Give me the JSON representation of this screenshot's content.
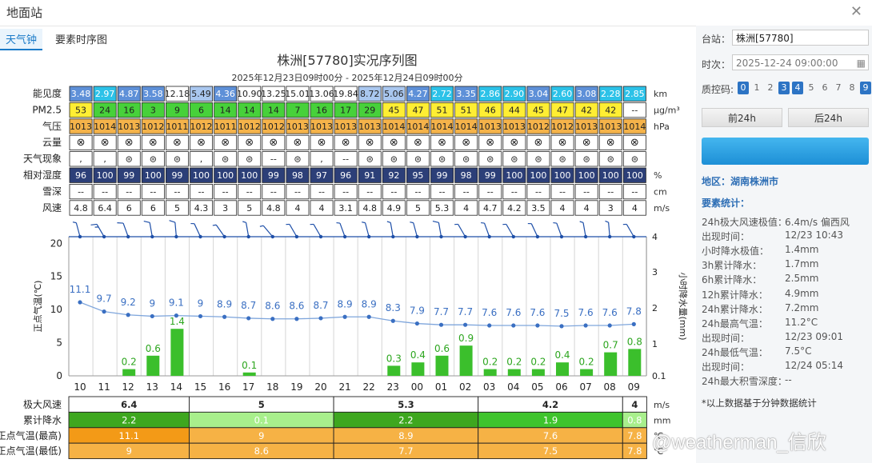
{
  "window": {
    "title": "地面站",
    "close_icon": "close-icon"
  },
  "tabs": [
    {
      "label": "天气钟",
      "active": true
    },
    {
      "label": "要素时序图",
      "active": false
    }
  ],
  "chart_header": {
    "title": "株洲[57780]实况序列图",
    "subtitle": "2025年12月23日09时00分 - 2025年12月24日09时00分"
  },
  "table": {
    "hours": [
      "10",
      "11",
      "12",
      "13",
      "14",
      "15",
      "16",
      "17",
      "18",
      "19",
      "20",
      "21",
      "22",
      "23",
      "00",
      "01",
      "02",
      "03",
      "04",
      "05",
      "06",
      "07",
      "08",
      "09"
    ],
    "rows": [
      {
        "label": "能见度",
        "unit": "km",
        "values": [
          "3.48",
          "2.97",
          "4.87",
          "3.58",
          "12.18",
          "5.49",
          "4.36",
          "10.90",
          "13.25",
          "15.01",
          "13.06",
          "19.84",
          "8.72",
          "5.06",
          "4.27",
          "2.72",
          "3.35",
          "2.86",
          "2.90",
          "3.04",
          "2.60",
          "3.08",
          "2.28",
          "2.85"
        ]
      },
      {
        "label": "PM2.5",
        "unit": "μg/m³",
        "values": [
          "53",
          "24",
          "16",
          "3",
          "9",
          "6",
          "14",
          "14",
          "14",
          "7",
          "16",
          "17",
          "29",
          "45",
          "47",
          "51",
          "51",
          "46",
          "44",
          "45",
          "47",
          "42",
          "42",
          "--"
        ]
      },
      {
        "label": "气压",
        "unit": "hPa",
        "values": [
          "1013",
          "1014",
          "1013",
          "1012",
          "1011",
          "1012",
          "1011",
          "1012",
          "1012",
          "1013",
          "1013",
          "1013",
          "1013",
          "1014",
          "1014",
          "1014",
          "1014",
          "1013",
          "1013",
          "1012",
          "1012",
          "1013",
          "1013",
          "1014"
        ]
      },
      {
        "label": "云量",
        "unit": "",
        "values": [
          "⊗",
          "⊗",
          "⊗",
          "⊗",
          "⊗",
          "⊗",
          "⊗",
          "⊗",
          "⊗",
          "⊗",
          "⊗",
          "⊗",
          "⊗",
          "⊗",
          "⊗",
          "⊗",
          "⊗",
          "⊗",
          "⊗",
          "⊗",
          "⊗",
          "⊗",
          "⊗",
          "⊗"
        ]
      },
      {
        "label": "天气现象",
        "unit": "",
        "values": [
          ",",
          ",",
          "⊜",
          "⊜",
          "⊜",
          ",",
          "⊜",
          "⊜",
          "--",
          "⊜",
          ",",
          "--",
          "⊜",
          "⊜",
          "⊜",
          "⊜",
          "⊜",
          "⊜",
          "⊜",
          "⊜",
          "⊜",
          "⊜",
          "⊜",
          "⊜"
        ]
      },
      {
        "label": "相对湿度",
        "unit": "%",
        "values": [
          "96",
          "100",
          "99",
          "100",
          "99",
          "100",
          "100",
          "100",
          "99",
          "98",
          "97",
          "96",
          "91",
          "92",
          "95",
          "99",
          "98",
          "99",
          "100",
          "100",
          "100",
          "100",
          "100",
          "100"
        ]
      },
      {
        "label": "雪深",
        "unit": "cm",
        "values": [
          "--",
          "--",
          "--",
          "--",
          "--",
          "--",
          "--",
          "--",
          "--",
          "--",
          "--",
          "--",
          "--",
          "--",
          "--",
          "--",
          "--",
          "--",
          "--",
          "--",
          "--",
          "--",
          "--",
          "--"
        ]
      },
      {
        "label": "风速",
        "unit": "m/s",
        "values": [
          "4.8",
          "6.4",
          "6",
          "6",
          "5",
          "4.3",
          "3",
          "5",
          "4.8",
          "4",
          "4",
          "3.1",
          "4.8",
          "4.9",
          "5",
          "5.3",
          "4",
          "4.7",
          "4.2",
          "3.5",
          "4",
          "4",
          "3",
          "4"
        ]
      }
    ]
  },
  "chart_data": {
    "type": "line",
    "x": [
      "10",
      "11",
      "12",
      "13",
      "14",
      "15",
      "16",
      "17",
      "18",
      "19",
      "20",
      "21",
      "22",
      "23",
      "00",
      "01",
      "02",
      "03",
      "04",
      "05",
      "06",
      "07",
      "08",
      "09"
    ],
    "series": [
      {
        "kind": "line",
        "axis": "left",
        "values": [
          11.1,
          9.7,
          9.2,
          9,
          9.1,
          9,
          8.9,
          8.7,
          8.6,
          8.6,
          8.7,
          8.9,
          8.9,
          8.3,
          7.9,
          7.7,
          7.7,
          7.6,
          7.6,
          7.6,
          7.5,
          7.6,
          7.6,
          7.8
        ],
        "color": "#3a6fc2"
      },
      {
        "kind": "bar",
        "axis": "right",
        "values": [
          null,
          null,
          0.2,
          0.6,
          1.4,
          null,
          null,
          0.1,
          null,
          null,
          null,
          null,
          null,
          0.3,
          0.4,
          0.6,
          0.9,
          0.2,
          0.2,
          0.2,
          0.4,
          0.2,
          0.7,
          0.8
        ],
        "color": "#3bbf2c"
      }
    ],
    "ylabel": "正点气温(℃)",
    "ylim": [
      0,
      21
    ],
    "yticks": [
      0,
      5,
      10,
      15,
      20
    ],
    "y2label": "小时降水量(mm)",
    "y2ticks": [
      "0.1",
      "1",
      "2",
      "3",
      "4"
    ],
    "wind_barbs": [
      {
        "dir": 345,
        "full": 0,
        "half": 1
      },
      {
        "dir": 330,
        "full": 1,
        "half": 1
      },
      {
        "dir": 340,
        "full": 1,
        "half": 0
      },
      {
        "dir": 350,
        "full": 1,
        "half": 0
      },
      {
        "dir": 355,
        "full": 1,
        "half": 0
      },
      {
        "dir": 335,
        "full": 0,
        "half": 1
      },
      {
        "dir": 325,
        "full": 0,
        "half": 1
      },
      {
        "dir": 350,
        "full": 0,
        "half": 1
      },
      {
        "dir": 320,
        "full": 0,
        "half": 1
      },
      {
        "dir": 330,
        "full": 0,
        "half": 1
      },
      {
        "dir": 330,
        "full": 0,
        "half": 1
      },
      {
        "dir": 340,
        "full": 0,
        "half": 1
      },
      {
        "dir": 345,
        "full": 0,
        "half": 1
      },
      {
        "dir": 350,
        "full": 0,
        "half": 1
      },
      {
        "dir": 345,
        "full": 0,
        "half": 1
      },
      {
        "dir": 350,
        "full": 1,
        "half": 0
      },
      {
        "dir": 330,
        "full": 0,
        "half": 1
      },
      {
        "dir": 340,
        "full": 0,
        "half": 1
      },
      {
        "dir": 330,
        "full": 0,
        "half": 1
      },
      {
        "dir": 335,
        "full": 0,
        "half": 1
      },
      {
        "dir": 340,
        "full": 0,
        "half": 1
      },
      {
        "dir": 350,
        "full": 0,
        "half": 1
      },
      {
        "dir": 355,
        "full": 0,
        "half": 1
      },
      {
        "dir": 330,
        "full": 0,
        "half": 1
      }
    ],
    "grid": true
  },
  "summary_table": {
    "units": [
      "m/s",
      "mm",
      "℃",
      "℃"
    ],
    "rows": [
      {
        "label": "极大风速",
        "cells": [
          "6.4",
          "5",
          "5.3",
          "4.2",
          "4"
        ]
      },
      {
        "label": "累计降水",
        "cells": [
          "2.2",
          "0.1",
          "2.2",
          "1.9",
          "0.8"
        ]
      },
      {
        "label": "正点气温(最高)",
        "cells": [
          "11.1",
          "9",
          "8.9",
          "7.6",
          "7.8"
        ]
      },
      {
        "label": "正点气温(最低)",
        "cells": [
          "9",
          "8.6",
          "7.7",
          "7.5",
          "7.8"
        ]
      }
    ]
  },
  "sidebar": {
    "station_label": "台站：",
    "station_value": "株洲[57780]",
    "time_label": "时次：",
    "time_value": "2025-12-24 09:00:00",
    "qc_label": "质控码:",
    "qc_codes": [
      "0",
      "1",
      "2",
      "3",
      "4",
      "5",
      "6",
      "7",
      "8",
      "9"
    ],
    "qc_active": [
      "0",
      "3",
      "4",
      "9"
    ],
    "prev_button": "前24h",
    "next_button": "后24h",
    "region": "地区：湖南株洲市",
    "stats_title": "要素统计：",
    "stats": [
      {
        "k": "24h极大风速极值：",
        "v": "6.4m/s 偏西风"
      },
      {
        "k": "出现时间：",
        "v": "12/23 10:43"
      },
      {
        "k": "小时降水极值：",
        "v": "1.4mm"
      },
      {
        "k": "3h累计降水：",
        "v": "1.7mm"
      },
      {
        "k": "6h累计降水：",
        "v": "2.5mm"
      },
      {
        "k": "12h累计降水：",
        "v": "4.9mm"
      },
      {
        "k": "24h累计降水：",
        "v": "7.2mm"
      },
      {
        "k": "24h最高气温：",
        "v": "11.2°C"
      },
      {
        "k": "出现时间：",
        "v": "12/23 09:01"
      },
      {
        "k": "24h最低气温：",
        "v": "7.5°C"
      },
      {
        "k": "出现时间：",
        "v": "12/24 05:14"
      },
      {
        "k": "24h最大积雪深度：",
        "v": "--"
      }
    ],
    "footnote": "*以上数据基于分钟数据统计"
  },
  "watermark": "@weatherman_信欣"
}
